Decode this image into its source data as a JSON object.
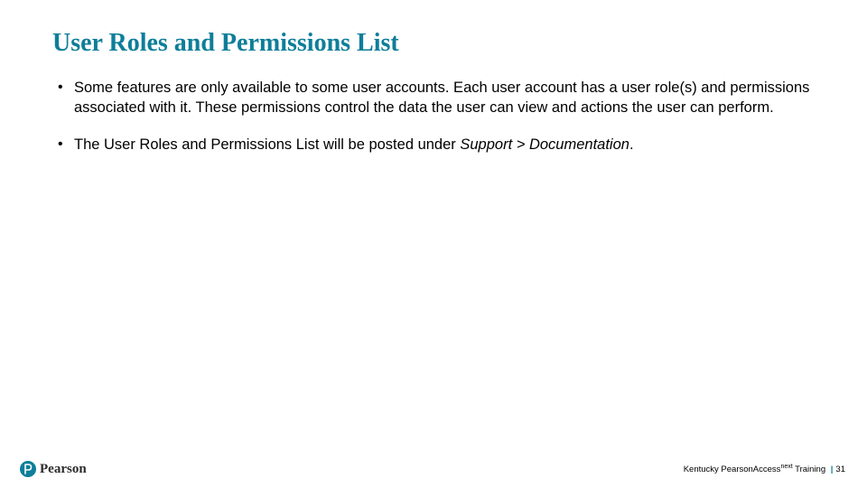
{
  "title": "User Roles and Permissions List",
  "bullets": {
    "b1": "Some features are only available to some user accounts. Each user account has a user role(s) and permissions associated with it. These permissions control the data the user can view and actions the user can perform.",
    "b2_pre": "The User Roles and Permissions List will be posted under ",
    "b2_italic": "Support > Documentation",
    "b2_post": "."
  },
  "brand": "Pearson",
  "footer": {
    "pre": "Kentucky PearsonAccess",
    "sup": "next",
    "post": " Training",
    "bar": "|",
    "page": "31"
  }
}
